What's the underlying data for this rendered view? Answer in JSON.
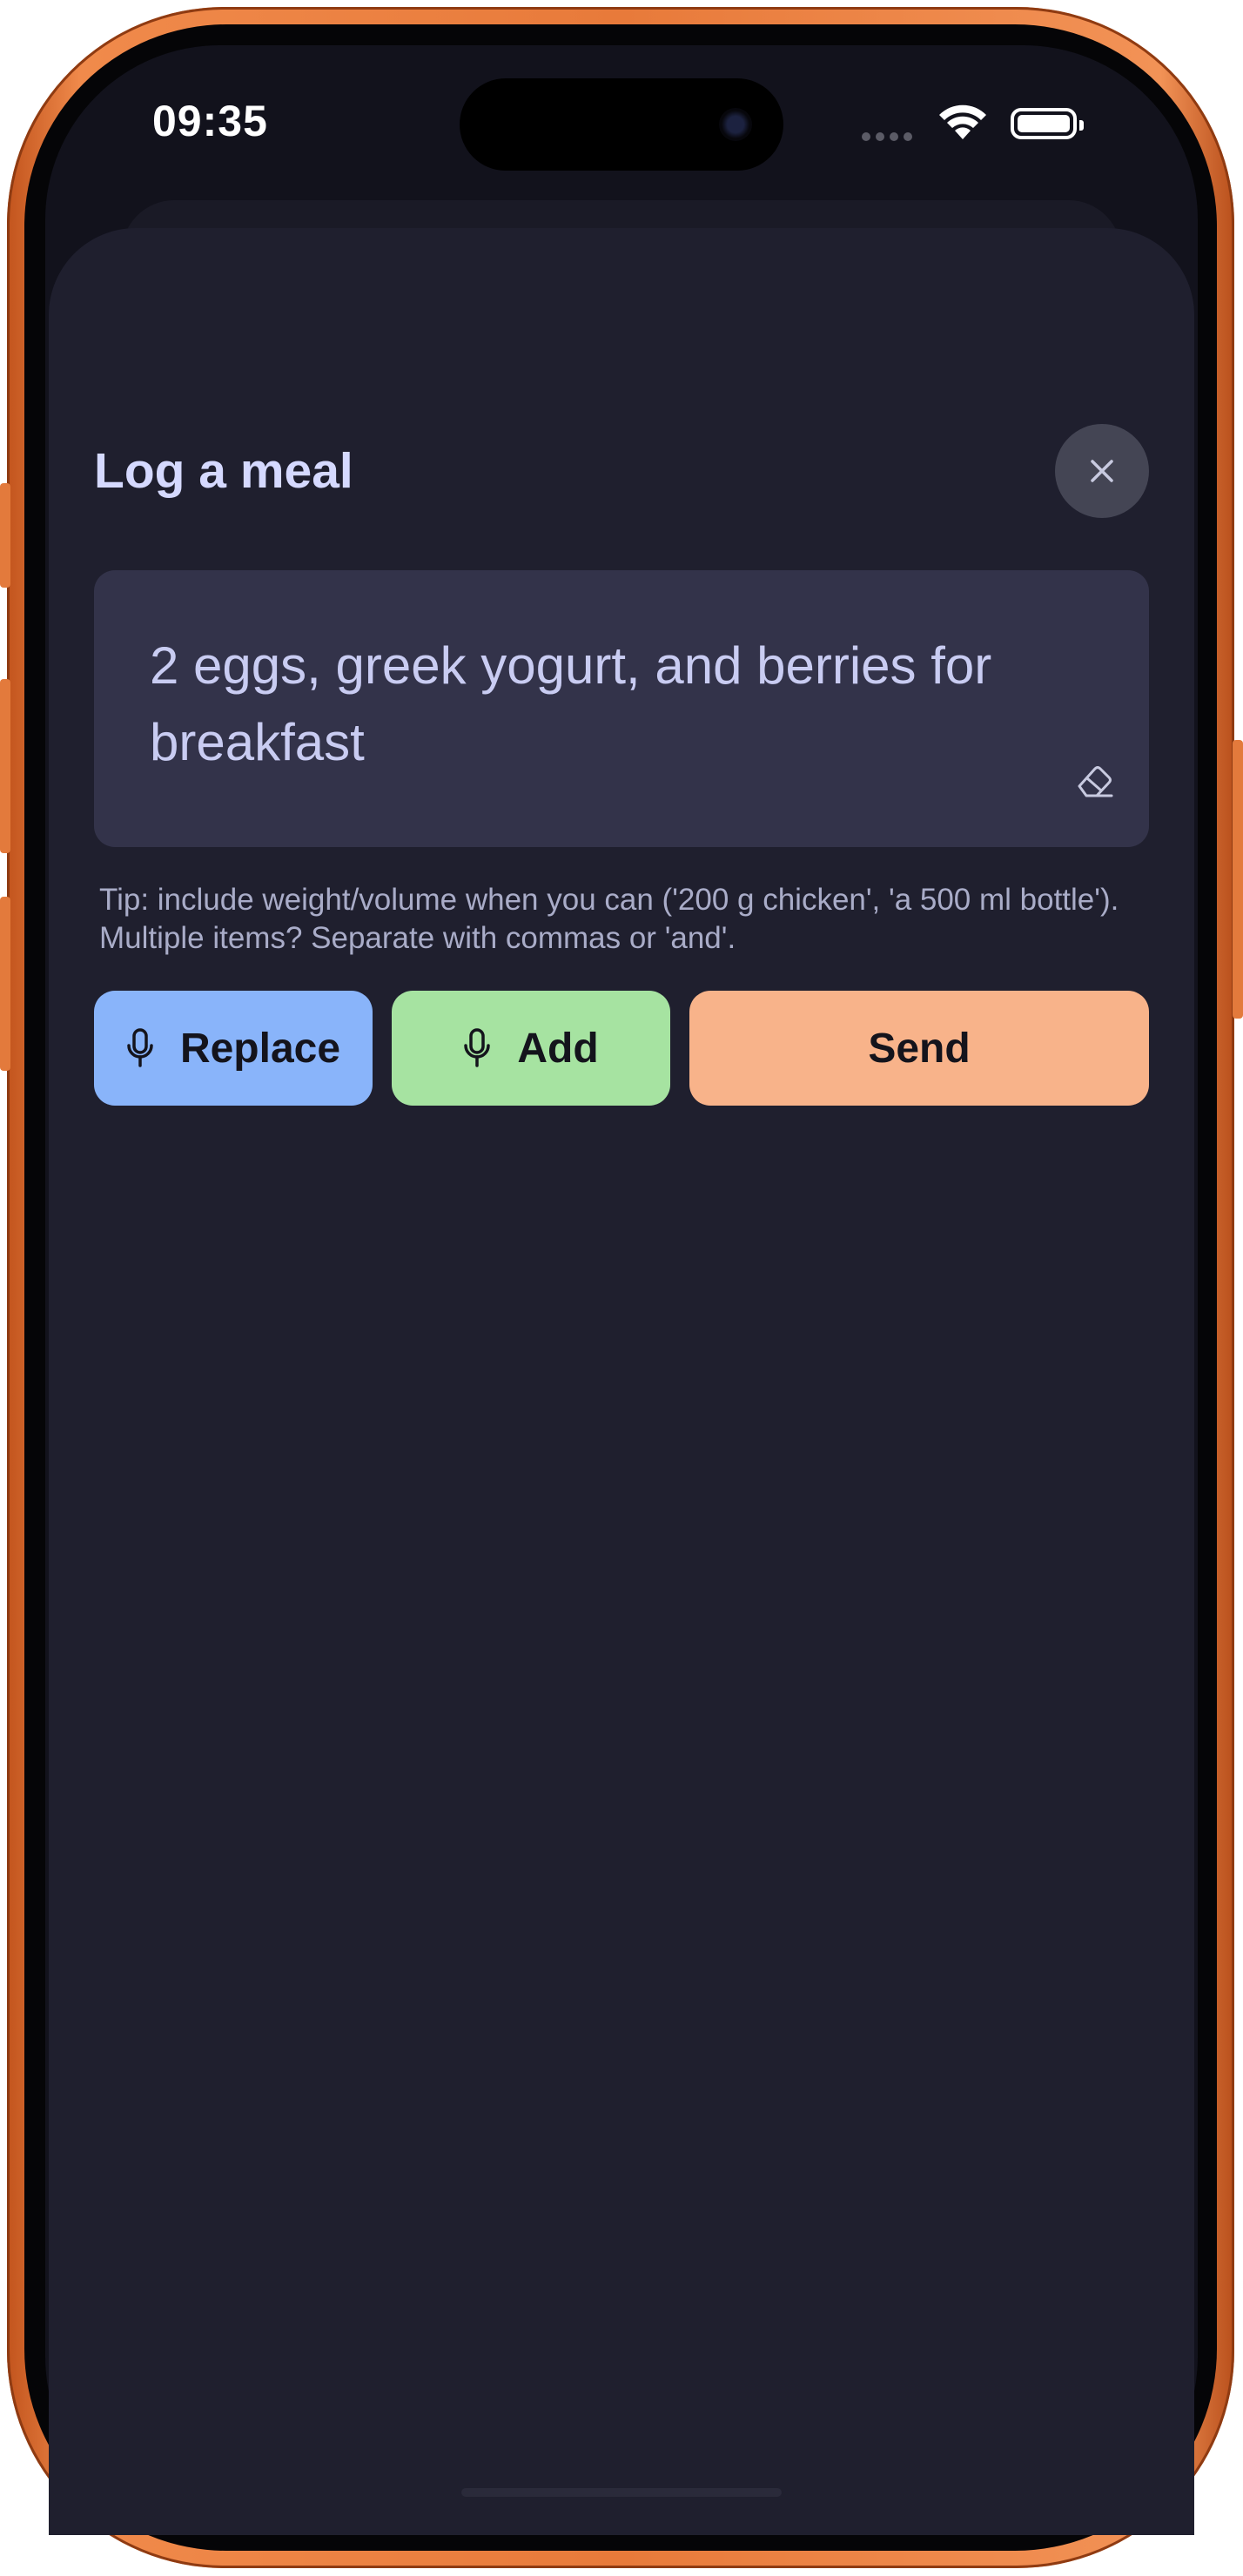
{
  "status_bar": {
    "time": "09:35"
  },
  "sheet": {
    "title": "Log a meal",
    "close_icon": "close-icon",
    "input": {
      "value": "2 eggs, greek yogurt, and berries for breakfast"
    },
    "clear_icon": "eraser-icon",
    "tip": "Tip: include weight/volume when you can ('200 g chicken', 'a 500 ml bottle'). Multiple items? Separate with commas or 'and'."
  },
  "actions": {
    "replace_label": "Replace",
    "add_label": "Add",
    "send_label": "Send",
    "mic_icon": "microphone-icon"
  },
  "colors": {
    "frame": "#e87a3a",
    "sheet_bg": "#1f1f2e",
    "input_bg": "#33334a",
    "title_text": "#d5d9ff",
    "replace_bg": "#89b4fa",
    "add_bg": "#a6e3a1",
    "send_bg": "#f8b38a"
  }
}
